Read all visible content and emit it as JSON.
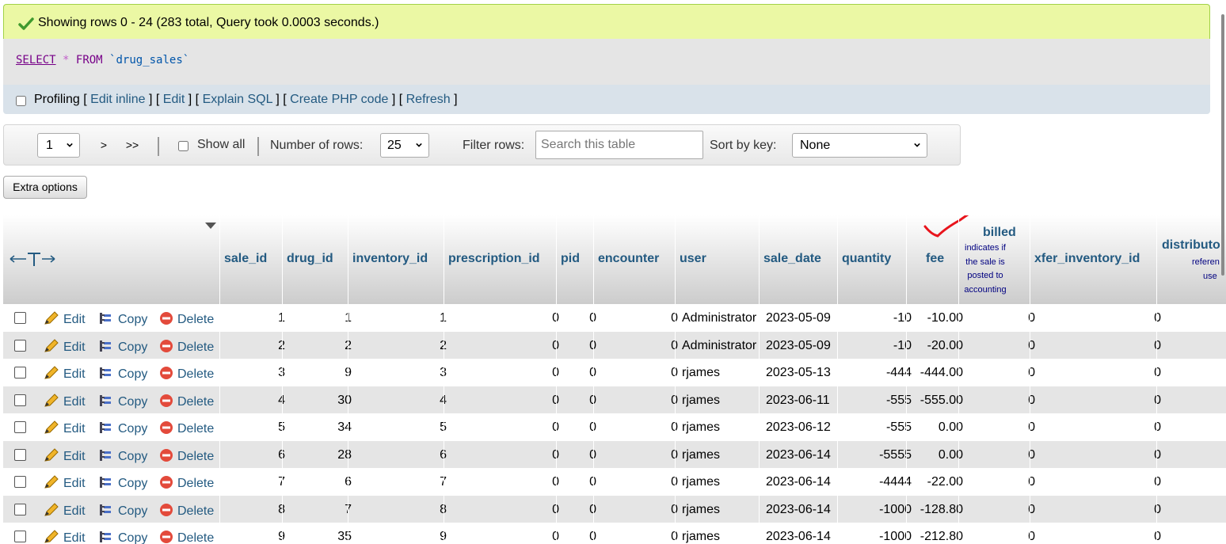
{
  "message": "Showing rows 0 - 24 (283 total, Query took 0.0003 seconds.)",
  "sql": {
    "select": "SELECT",
    "star": "*",
    "from": "FROM",
    "table": "`drug_sales`"
  },
  "tools": {
    "profiling": "Profiling",
    "links": [
      "Edit inline",
      "Edit",
      "Explain SQL",
      "Create PHP code",
      "Refresh"
    ]
  },
  "nav": {
    "page": "1",
    "next": ">",
    "last": ">>",
    "show_all": "Show all",
    "rows_label": "Number of rows:",
    "rows_value": "25",
    "filter_label": "Filter rows:",
    "filter_placeholder": "Search this table",
    "sort_label": "Sort by key:",
    "sort_value": "None"
  },
  "extra_options": "Extra options",
  "columns": {
    "sale_id": "sale_id",
    "drug_id": "drug_id",
    "inventory_id": "inventory_id",
    "prescription_id": "prescription_id",
    "pid": "pid",
    "encounter": "encounter",
    "user": "user",
    "sale_date": "sale_date",
    "quantity": "quantity",
    "fee": "fee",
    "billed": "billed",
    "billed_comment": [
      "indicates if",
      "the sale is",
      "posted to",
      "accounting"
    ],
    "xfer_inventory_id": "xfer_inventory_id",
    "distributor": "distributo",
    "distributor_comment": [
      "referen",
      "use"
    ]
  },
  "actions": {
    "edit": "Edit",
    "copy": "Copy",
    "delete": "Delete"
  },
  "rows": [
    {
      "sale_id": "1",
      "drug_id": "1",
      "inventory_id": "1",
      "prescription_id": "0",
      "pid": "0",
      "encounter": "0",
      "user": "Administrator",
      "sale_date": "2023-05-09",
      "quantity": "-10",
      "fee": "-10.00",
      "billed": "0",
      "xfer": "0"
    },
    {
      "sale_id": "2",
      "drug_id": "2",
      "inventory_id": "2",
      "prescription_id": "0",
      "pid": "0",
      "encounter": "0",
      "user": "Administrator",
      "sale_date": "2023-05-09",
      "quantity": "-10",
      "fee": "-20.00",
      "billed": "0",
      "xfer": "0"
    },
    {
      "sale_id": "3",
      "drug_id": "9",
      "inventory_id": "3",
      "prescription_id": "0",
      "pid": "0",
      "encounter": "0",
      "user": "rjames",
      "sale_date": "2023-05-13",
      "quantity": "-444",
      "fee": "-444.00",
      "billed": "0",
      "xfer": "0"
    },
    {
      "sale_id": "4",
      "drug_id": "30",
      "inventory_id": "4",
      "prescription_id": "0",
      "pid": "0",
      "encounter": "0",
      "user": "rjames",
      "sale_date": "2023-06-11",
      "quantity": "-555",
      "fee": "-555.00",
      "billed": "0",
      "xfer": "0"
    },
    {
      "sale_id": "5",
      "drug_id": "34",
      "inventory_id": "5",
      "prescription_id": "0",
      "pid": "0",
      "encounter": "0",
      "user": "rjames",
      "sale_date": "2023-06-12",
      "quantity": "-555",
      "fee": "0.00",
      "billed": "0",
      "xfer": "0"
    },
    {
      "sale_id": "6",
      "drug_id": "28",
      "inventory_id": "6",
      "prescription_id": "0",
      "pid": "0",
      "encounter": "0",
      "user": "rjames",
      "sale_date": "2023-06-14",
      "quantity": "-5555",
      "fee": "0.00",
      "billed": "0",
      "xfer": "0"
    },
    {
      "sale_id": "7",
      "drug_id": "6",
      "inventory_id": "7",
      "prescription_id": "0",
      "pid": "0",
      "encounter": "0",
      "user": "rjames",
      "sale_date": "2023-06-14",
      "quantity": "-4444",
      "fee": "-22.00",
      "billed": "0",
      "xfer": "0"
    },
    {
      "sale_id": "8",
      "drug_id": "7",
      "inventory_id": "8",
      "prescription_id": "0",
      "pid": "0",
      "encounter": "0",
      "user": "rjames",
      "sale_date": "2023-06-14",
      "quantity": "-1000",
      "fee": "-128.80",
      "billed": "0",
      "xfer": "0"
    },
    {
      "sale_id": "9",
      "drug_id": "35",
      "inventory_id": "9",
      "prescription_id": "0",
      "pid": "0",
      "encounter": "0",
      "user": "rjames",
      "sale_date": "2023-06-14",
      "quantity": "-1000",
      "fee": "-212.80",
      "billed": "0",
      "xfer": "0"
    }
  ],
  "colors": {
    "success_bg": "#ebf8a4",
    "link": "#235a81",
    "alt_row": "#e5e5e5",
    "annotation": "#e8141c"
  }
}
